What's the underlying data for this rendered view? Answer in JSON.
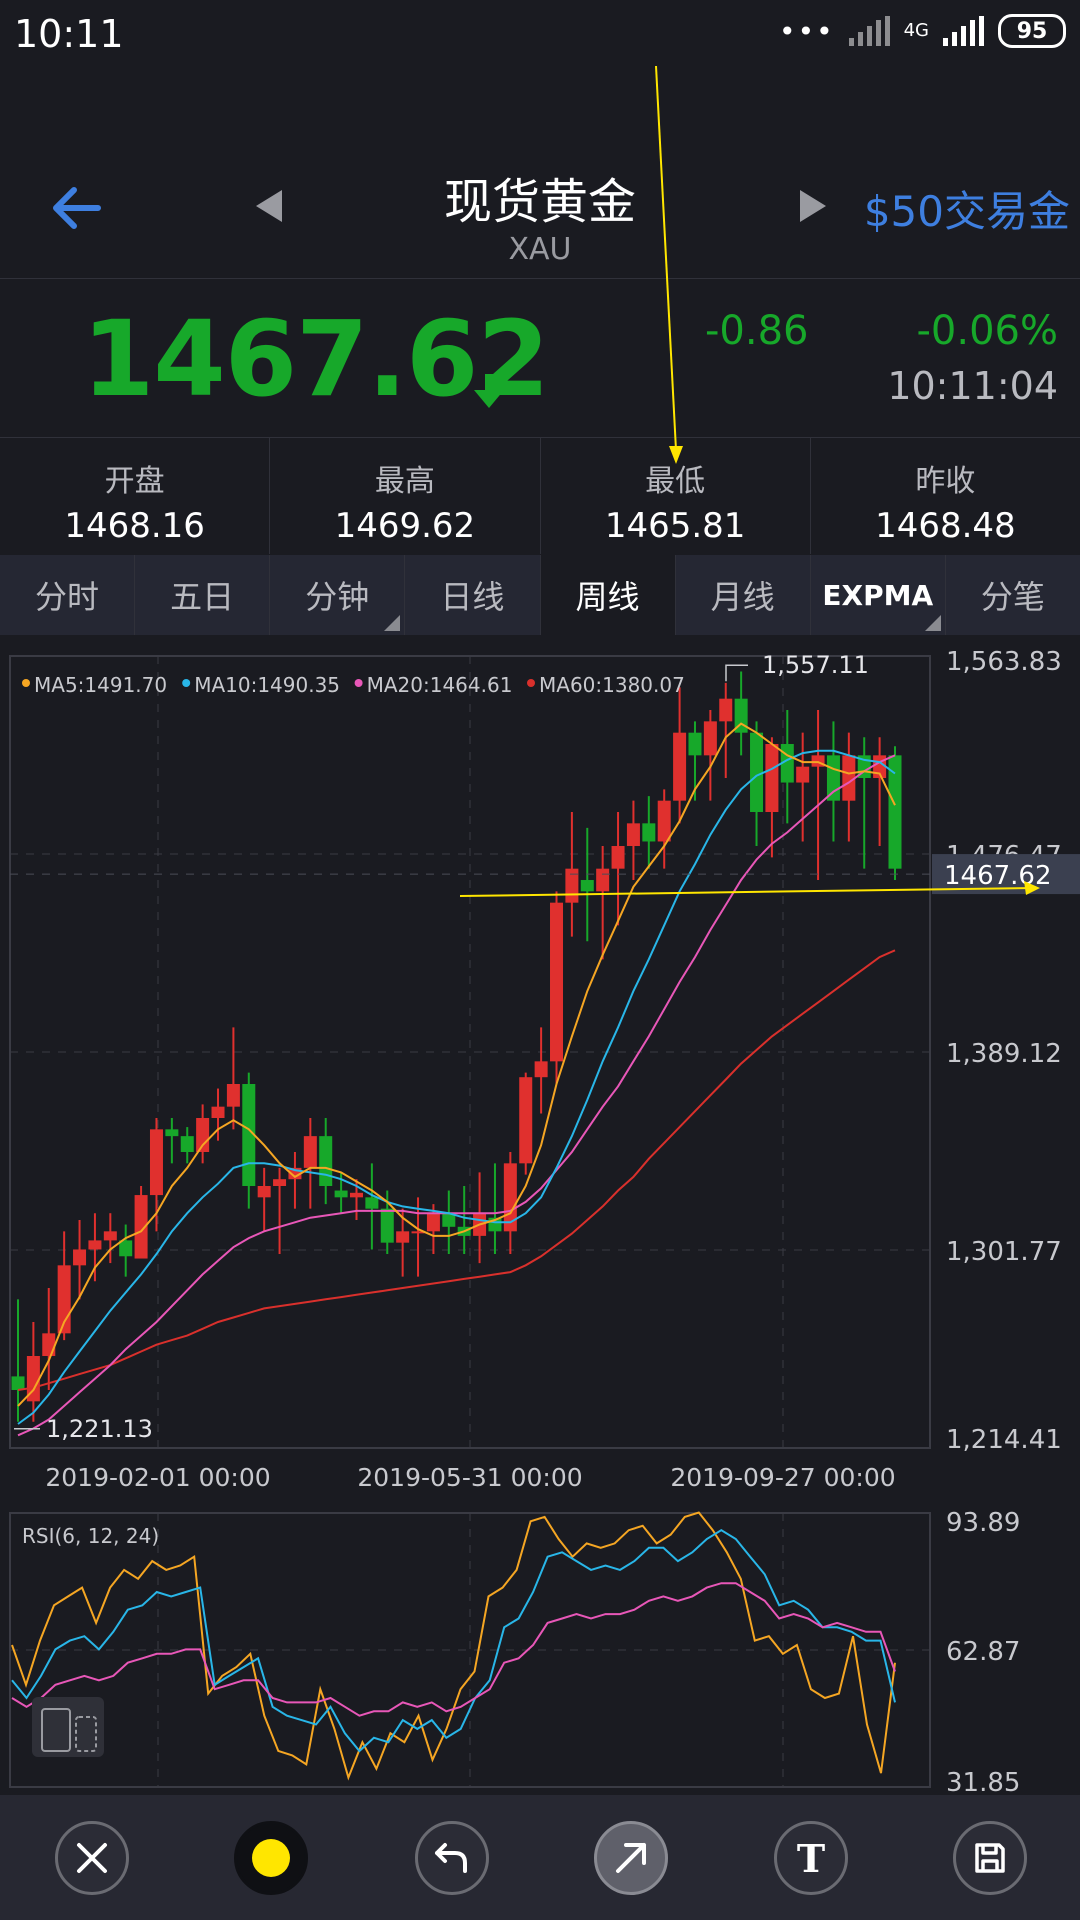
{
  "status_bar": {
    "time": "10:11",
    "network": "4G",
    "battery": "95"
  },
  "header": {
    "title": "现货黄金",
    "symbol": "XAU",
    "trade_link": "$50交易金"
  },
  "quote": {
    "price": "1467.62",
    "change": "-0.86",
    "change_pct": "-0.06%",
    "time": "10:11:04"
  },
  "stats": [
    {
      "label": "开盘",
      "value": "1468.16"
    },
    {
      "label": "最高",
      "value": "1469.62"
    },
    {
      "label": "最低",
      "value": "1465.81"
    },
    {
      "label": "昨收",
      "value": "1468.48"
    }
  ],
  "tabs": [
    {
      "label": "分时"
    },
    {
      "label": "五日"
    },
    {
      "label": "分钟"
    },
    {
      "label": "日线"
    },
    {
      "label": "周线"
    },
    {
      "label": "月线"
    },
    {
      "label": "EXPMA"
    },
    {
      "label": "分笔"
    }
  ],
  "colors": {
    "up": "#e0302e",
    "down": "#17a82a",
    "ma5": "#f5a623",
    "ma10": "#29b6e8",
    "ma20": "#e857b8",
    "ma60": "#d9302c",
    "annotation": "#ffe600",
    "accent": "#3e7fe0"
  },
  "chart_data": [
    {
      "type": "candlestick",
      "legend": [
        {
          "label": "MA5:1491.70",
          "color": "#f5a623"
        },
        {
          "label": "MA10:1490.35",
          "color": "#29b6e8"
        },
        {
          "label": "MA20:1464.61",
          "color": "#e857b8"
        },
        {
          "label": "MA60:1380.07",
          "color": "#d9302c"
        }
      ],
      "y_labels": [
        "1,563.83",
        "1,476.47",
        "1,389.12",
        "1,301.77",
        "1,214.41"
      ],
      "ylim": [
        1214.41,
        1563.83
      ],
      "x_labels": [
        "2019-02-01 00:00",
        "2019-05-31 00:00",
        "2019-09-27 00:00"
      ],
      "high_label": "1,557.11",
      "low_label": "1,221.13",
      "current_price_label": "1467.62",
      "current_price": 1467.62,
      "candles": [
        [
          1246,
          1280,
          1226,
          1240
        ],
        [
          1235,
          1270,
          1226,
          1255
        ],
        [
          1255,
          1285,
          1240,
          1265
        ],
        [
          1265,
          1310,
          1262,
          1295
        ],
        [
          1295,
          1315,
          1280,
          1302
        ],
        [
          1302,
          1318,
          1288,
          1306
        ],
        [
          1306,
          1318,
          1296,
          1310
        ],
        [
          1306,
          1313,
          1290,
          1299
        ],
        [
          1298,
          1330,
          1298,
          1326
        ],
        [
          1326,
          1360,
          1310,
          1355
        ],
        [
          1355,
          1360,
          1340,
          1352
        ],
        [
          1352,
          1356,
          1340,
          1345
        ],
        [
          1345,
          1366,
          1340,
          1360
        ],
        [
          1360,
          1373,
          1350,
          1365
        ],
        [
          1365,
          1400,
          1355,
          1375
        ],
        [
          1375,
          1380,
          1320,
          1330
        ],
        [
          1325,
          1338,
          1310,
          1330
        ],
        [
          1330,
          1338,
          1300,
          1333
        ],
        [
          1333,
          1345,
          1320,
          1338
        ],
        [
          1338,
          1360,
          1320,
          1352
        ],
        [
          1352,
          1360,
          1322,
          1330
        ],
        [
          1328,
          1336,
          1318,
          1325
        ],
        [
          1325,
          1333,
          1315,
          1327
        ],
        [
          1325,
          1340,
          1302,
          1320
        ],
        [
          1320,
          1328,
          1300,
          1305
        ],
        [
          1305,
          1320,
          1290,
          1310
        ],
        [
          1310,
          1325,
          1290,
          1310
        ],
        [
          1310,
          1322,
          1300,
          1318
        ],
        [
          1318,
          1328,
          1300,
          1312
        ],
        [
          1312,
          1330,
          1300,
          1308
        ],
        [
          1308,
          1336,
          1296,
          1318
        ],
        [
          1316,
          1340,
          1300,
          1310
        ],
        [
          1310,
          1345,
          1300,
          1340
        ],
        [
          1340,
          1380,
          1335,
          1378
        ],
        [
          1378,
          1400,
          1362,
          1385
        ],
        [
          1385,
          1460,
          1375,
          1455
        ],
        [
          1455,
          1495,
          1440,
          1470
        ],
        [
          1465,
          1488,
          1438,
          1460
        ],
        [
          1460,
          1480,
          1430,
          1470
        ],
        [
          1470,
          1495,
          1445,
          1480
        ],
        [
          1480,
          1500,
          1465,
          1490
        ],
        [
          1490,
          1502,
          1470,
          1482
        ],
        [
          1482,
          1505,
          1470,
          1500
        ],
        [
          1500,
          1550,
          1490,
          1530
        ],
        [
          1530,
          1535,
          1500,
          1520
        ],
        [
          1520,
          1540,
          1500,
          1535
        ],
        [
          1535,
          1552,
          1510,
          1545
        ],
        [
          1545,
          1557,
          1520,
          1530
        ],
        [
          1530,
          1535,
          1480,
          1495
        ],
        [
          1495,
          1528,
          1475,
          1525
        ],
        [
          1525,
          1540,
          1490,
          1508
        ],
        [
          1508,
          1530,
          1482,
          1515
        ],
        [
          1515,
          1540,
          1465,
          1520
        ],
        [
          1520,
          1535,
          1482,
          1500
        ],
        [
          1500,
          1530,
          1482,
          1520
        ],
        [
          1520,
          1528,
          1470,
          1510
        ],
        [
          1510,
          1528,
          1480,
          1520
        ],
        [
          1520,
          1524,
          1465,
          1470
        ]
      ],
      "ma5": [
        1233,
        1240,
        1253,
        1270,
        1281,
        1294,
        1302,
        1307,
        1310,
        1318,
        1330,
        1338,
        1348,
        1355,
        1359,
        1355,
        1348,
        1340,
        1334,
        1338,
        1338,
        1336,
        1332,
        1328,
        1323,
        1316,
        1311,
        1308,
        1308,
        1310,
        1313,
        1315,
        1318,
        1330,
        1348,
        1375,
        1396,
        1416,
        1432,
        1447,
        1462,
        1471,
        1480,
        1491,
        1505,
        1515,
        1528,
        1534,
        1530,
        1525,
        1520,
        1517,
        1517,
        1514,
        1512,
        1513,
        1512,
        1498
      ],
      "ma10": [
        1225,
        1230,
        1238,
        1248,
        1257,
        1266,
        1275,
        1283,
        1291,
        1300,
        1310,
        1318,
        1325,
        1331,
        1338,
        1340,
        1340,
        1339,
        1337,
        1336,
        1335,
        1333,
        1330,
        1326,
        1323,
        1321,
        1320,
        1319,
        1318,
        1316,
        1315,
        1314,
        1314,
        1318,
        1325,
        1338,
        1352,
        1368,
        1385,
        1400,
        1416,
        1430,
        1445,
        1460,
        1472,
        1485,
        1496,
        1505,
        1511,
        1514,
        1518,
        1521,
        1522,
        1522,
        1520,
        1518,
        1517,
        1512
      ],
      "ma20": [
        1220,
        1223,
        1227,
        1233,
        1239,
        1245,
        1251,
        1258,
        1264,
        1270,
        1277,
        1284,
        1291,
        1297,
        1303,
        1307,
        1310,
        1312,
        1314,
        1316,
        1317,
        1318,
        1319,
        1319,
        1319,
        1319,
        1318,
        1318,
        1318,
        1318,
        1318,
        1318,
        1319,
        1323,
        1329,
        1337,
        1345,
        1355,
        1365,
        1374,
        1385,
        1396,
        1408,
        1420,
        1431,
        1443,
        1454,
        1465,
        1474,
        1481,
        1486,
        1492,
        1498,
        1504,
        1508,
        1513,
        1517,
        1520
      ],
      "ma60": [
        1240,
        1241,
        1243,
        1245,
        1247,
        1249,
        1251,
        1254,
        1257,
        1260,
        1262,
        1264,
        1267,
        1270,
        1272,
        1274,
        1276,
        1277,
        1278,
        1279,
        1280,
        1281,
        1282,
        1283,
        1284,
        1285,
        1286,
        1287,
        1288,
        1289,
        1290,
        1291,
        1292,
        1295,
        1299,
        1304,
        1309,
        1315,
        1321,
        1328,
        1334,
        1342,
        1349,
        1356,
        1363,
        1370,
        1377,
        1384,
        1390,
        1396,
        1401,
        1406,
        1411,
        1416,
        1421,
        1426,
        1431,
        1434
      ]
    },
    {
      "type": "line",
      "title": "RSI(6, 12, 24)",
      "y_labels": [
        "93.89",
        "62.87",
        "31.85"
      ],
      "ylim": [
        31.85,
        93.89
      ],
      "series": [
        {
          "color": "#f5a623",
          "values": [
            64,
            55,
            65,
            73,
            75,
            77,
            69,
            77,
            81,
            79,
            83,
            81,
            82,
            84,
            53,
            57,
            59,
            62,
            48,
            40,
            39,
            37,
            54,
            45,
            34,
            42,
            36,
            44,
            42,
            48,
            38,
            45,
            54,
            58,
            75,
            77,
            81,
            92,
            93,
            88,
            84,
            87,
            86,
            87,
            90,
            91,
            87,
            89,
            93,
            94,
            90,
            85,
            79,
            65,
            66,
            62,
            64,
            54,
            52,
            53,
            66,
            46,
            35,
            60
          ]
        },
        {
          "color": "#29b6e8",
          "values": [
            56,
            52,
            57,
            63,
            65,
            66,
            63,
            67,
            72,
            73,
            76,
            75,
            76,
            77,
            55,
            57,
            59,
            61,
            50,
            48,
            47,
            46,
            50,
            44,
            40,
            43,
            42,
            47,
            45,
            47,
            43,
            45,
            52,
            56,
            68,
            70,
            76,
            84,
            85,
            83,
            81,
            82,
            81,
            83,
            86,
            86,
            83,
            85,
            88,
            90,
            88,
            84,
            80,
            73,
            74,
            72,
            68,
            68,
            67,
            65,
            65,
            51
          ]
        },
        {
          "color": "#e857b8",
          "values": [
            52,
            50,
            52,
            55,
            56,
            57,
            56,
            57,
            60,
            61,
            62,
            62,
            63,
            63,
            54,
            55,
            56,
            56,
            52,
            51,
            51,
            51,
            52,
            50,
            48,
            49,
            49,
            51,
            50,
            51,
            49,
            50,
            52,
            54,
            60,
            61,
            64,
            69,
            70,
            71,
            70,
            71,
            71,
            72,
            74,
            75,
            74,
            75,
            77,
            78,
            78,
            76,
            74,
            70,
            71,
            70,
            68,
            69,
            68,
            67,
            67,
            58
          ]
        }
      ]
    }
  ],
  "toolbar": {
    "text_tool": "T"
  }
}
